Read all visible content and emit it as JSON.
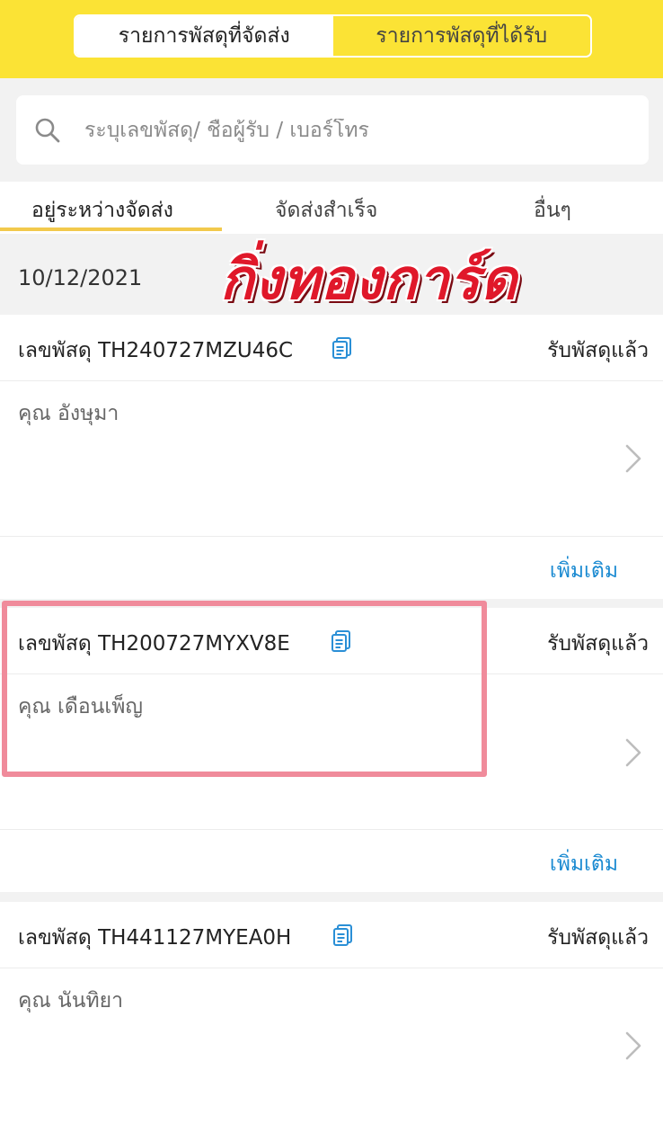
{
  "header": {
    "segments": [
      {
        "label": "รายการพัสดุที่จัดส่ง",
        "active": true
      },
      {
        "label": "รายการพัสดุที่ได้รับ",
        "active": false
      }
    ]
  },
  "search": {
    "placeholder": "ระบุเลขพัสดุ/ ชื่อผู้รับ / เบอร์โทร",
    "icon": "search-icon"
  },
  "tabs": [
    {
      "label": "อยู่ระหว่างจัดส่ง",
      "active": true
    },
    {
      "label": "จัดส่งสำเร็จ",
      "active": false
    },
    {
      "label": "อื่นๆ",
      "active": false
    }
  ],
  "date": "10/12/2021",
  "watermark": "กิ่งทองการ์ด",
  "parcels": [
    {
      "tracking": "เลขพัสดุ TH240727MZU46C",
      "status": "รับพัสดุแล้ว",
      "recipient": "คุณ อังษุมา",
      "more": "เพิ่มเติม"
    },
    {
      "tracking": "เลขพัสดุ TH200727MYXV8E",
      "status": "รับพัสดุแล้ว",
      "recipient": "คุณ เดือนเพ็ญ",
      "more": "เพิ่มเติม"
    },
    {
      "tracking": "เลขพัสดุ TH441127MYEA0H",
      "status": "รับพัสดุแล้ว",
      "recipient": "คุณ นันทิยา"
    }
  ],
  "colors": {
    "brand_yellow": "#fbe335",
    "link_blue": "#1a8ad1",
    "highlight_pink": "#f08b9b",
    "watermark_red": "#e0182a"
  }
}
